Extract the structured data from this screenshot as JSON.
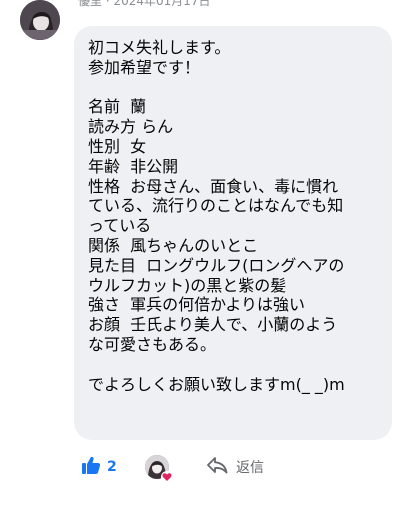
{
  "comment": {
    "author_meta": "優里 · 2024年01月17日",
    "lines": [
      "初コメ失礼します。",
      "参加希望です！",
      "",
      "名前  蘭",
      "読み方 らん",
      "性別  女",
      "年齢  非公開",
      "性格  お母さん、面食い、毒に慣れ",
      "ている、流行りのことはなんでも知",
      "っている",
      "関係  風ちゃんのいとこ",
      "見た目  ロングウルフ(ロングヘアの",
      "ウルフカット)の黒と紫の髪",
      "強さ  軍兵の何倍かよりは強い",
      "お顔  壬氏より美人で、小蘭のよう",
      "な可愛さもある。",
      "",
      "でよろしくお願い致しますm(_ _)m"
    ]
  },
  "actions": {
    "like_count": "2",
    "reply_label": "返信"
  },
  "icons": {
    "like": "thumbs-up-icon",
    "reply": "reply-arrow-icon",
    "heart": "heart-icon"
  },
  "colors": {
    "accent": "#1877f2",
    "bubble": "#eef0f3",
    "heart": "#e0245e"
  }
}
